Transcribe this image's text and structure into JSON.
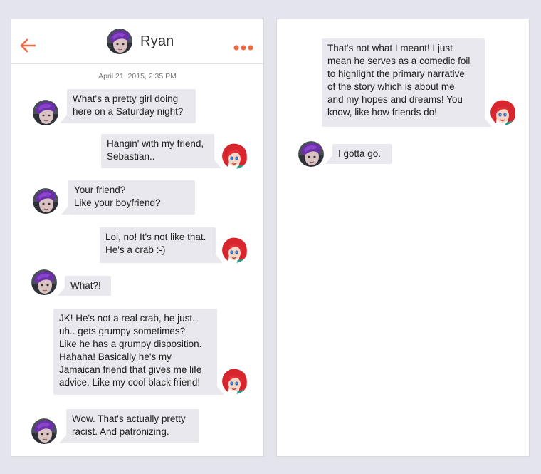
{
  "colors": {
    "accent": "#f06a44",
    "bubble": "#e8e8ee",
    "page_bg": "#e4e4ec"
  },
  "header": {
    "back_icon": "back-arrow-icon",
    "contact_name": "Ryan",
    "more_icon": "more-dots-icon"
  },
  "timestamp": "April 21, 2015, 2:35 PM",
  "messages": [
    {
      "sender": "Ryan",
      "text": "What's a pretty girl doing\nhere on a Saturday night?"
    },
    {
      "sender": "me",
      "text": "Hangin' with my friend,\nSebastian.."
    },
    {
      "sender": "Ryan",
      "text": "Your friend?\nLike your boyfriend?"
    },
    {
      "sender": "me",
      "text": "Lol, no! It's not like that.\nHe's a crab :-)"
    },
    {
      "sender": "Ryan",
      "text": "What?!"
    },
    {
      "sender": "me",
      "text": "JK! He's not a real crab, he just..\nuh.. gets grumpy sometimes?\nLike he has a grumpy disposition.\nHahaha! Basically he's my\nJamaican friend that gives me life\nadvice. Like my cool black friend!"
    },
    {
      "sender": "Ryan",
      "text": "Wow. That's actually pretty\nracist. And patronizing."
    },
    {
      "sender": "me",
      "text": "That's not what I meant! I just\nmean he serves as a comedic foil\nto highlight the primary narrative\nof the story which is about me\nand my hopes and dreams! You\nknow, like how friends do!"
    },
    {
      "sender": "Ryan",
      "text": "I gotta go."
    }
  ]
}
